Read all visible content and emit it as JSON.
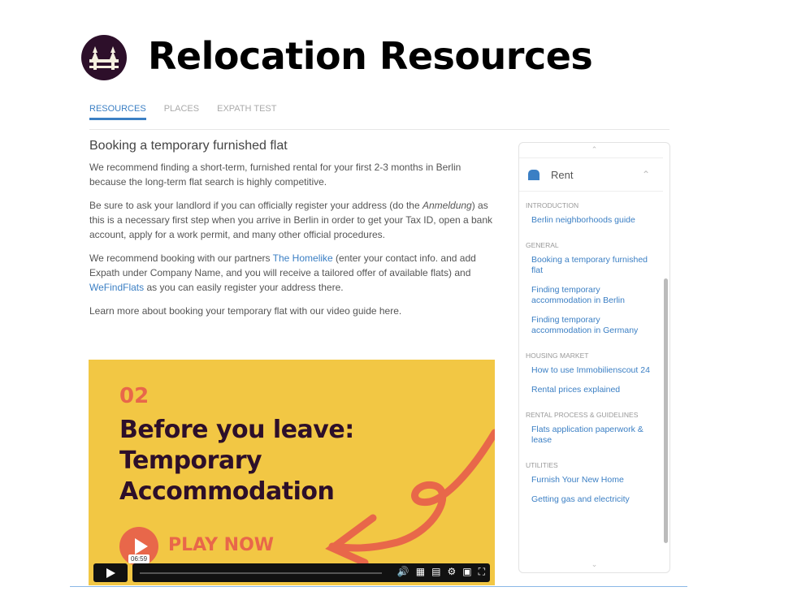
{
  "header": {
    "title": "Relocation Resources",
    "logo_icon": "berlin-bridge-logo"
  },
  "tabs": [
    {
      "label": "RESOURCES",
      "active": true
    },
    {
      "label": "PLACES"
    },
    {
      "label": "EXPATH TEST"
    }
  ],
  "article": {
    "heading": "Booking a temporary furnished flat",
    "p1": "We recommend finding a short-term, furnished rental for your first 2-3 months in Berlin because the long-term flat search is highly competitive.",
    "p2_a": "Be sure to ask your landlord if you can officially register your address (do the ",
    "p2_em": "Anmeldung",
    "p2_b": ") as this is a necessary first step when you arrive in Berlin in order to get your Tax ID, open a bank account, apply for a work permit, and many other official procedures.",
    "p3_a": "We recommend booking with our partners ",
    "p3_link1": "The Homelike",
    "p3_b": " (enter your contact info. and add Expath under Company Name, and you will receive a tailored offer of available flats) and ",
    "p3_link2": "WeFindFlats",
    "p3_c": " as you can easily register your address there.",
    "p4": "Learn more about booking your temporary flat with our video guide here."
  },
  "video": {
    "number": "02",
    "line1": "Before you leave:",
    "line2": "Temporary",
    "line3": "Accommodation",
    "cta": "PLAY NOW",
    "duration": "06:59",
    "progress": 0,
    "colors": {
      "bg": "#f2c744",
      "accent": "#e8674a",
      "text": "#2d0f2a"
    }
  },
  "sidebar": {
    "title": "Rent",
    "sections": [
      {
        "label": "INTRODUCTION",
        "items": [
          "Berlin neighborhoods guide"
        ]
      },
      {
        "label": "GENERAL",
        "items": [
          "Booking a temporary furnished flat",
          "Finding temporary accommodation in Berlin",
          "Finding temporary accommodation in Germany"
        ]
      },
      {
        "label": "HOUSING MARKET",
        "items": [
          "How to use Immobilienscout 24",
          "Rental prices explained"
        ]
      },
      {
        "label": "RENTAL PROCESS & GUIDELINES",
        "items": [
          "Flats application paperwork & lease"
        ]
      },
      {
        "label": "UTILITIES",
        "items": [
          "Furnish Your New Home",
          "Getting gas and electricity"
        ]
      }
    ]
  },
  "accent": "#3b7fc4"
}
